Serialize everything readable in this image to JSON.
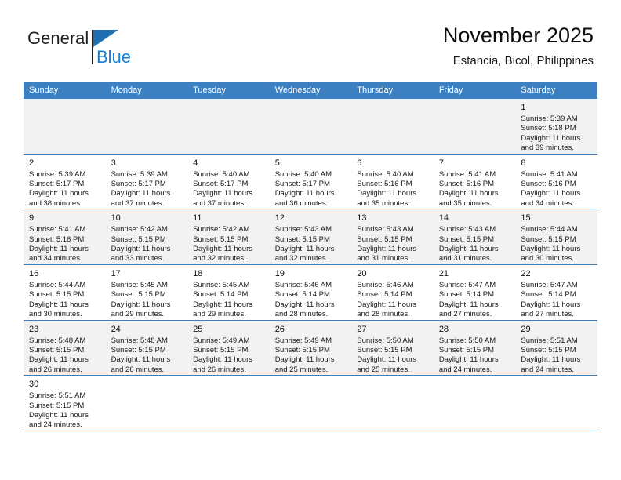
{
  "brand": {
    "name_part1": "General",
    "name_part2": "Blue"
  },
  "header": {
    "title": "November 2025",
    "subtitle": "Estancia, Bicol, Philippines"
  },
  "colors": {
    "header_blue": "#3d80c2",
    "logo_blue": "#1a7fd4",
    "shaded_row": "#f2f2f2"
  },
  "weekdays": [
    "Sunday",
    "Monday",
    "Tuesday",
    "Wednesday",
    "Thursday",
    "Friday",
    "Saturday"
  ],
  "weeks": [
    [
      {
        "day": "",
        "empty": true
      },
      {
        "day": "",
        "empty": true
      },
      {
        "day": "",
        "empty": true
      },
      {
        "day": "",
        "empty": true
      },
      {
        "day": "",
        "empty": true
      },
      {
        "day": "",
        "empty": true
      },
      {
        "day": "1",
        "sunrise": "Sunrise: 5:39 AM",
        "sunset": "Sunset: 5:18 PM",
        "daylight1": "Daylight: 11 hours",
        "daylight2": "and 39 minutes."
      }
    ],
    [
      {
        "day": "2",
        "sunrise": "Sunrise: 5:39 AM",
        "sunset": "Sunset: 5:17 PM",
        "daylight1": "Daylight: 11 hours",
        "daylight2": "and 38 minutes."
      },
      {
        "day": "3",
        "sunrise": "Sunrise: 5:39 AM",
        "sunset": "Sunset: 5:17 PM",
        "daylight1": "Daylight: 11 hours",
        "daylight2": "and 37 minutes."
      },
      {
        "day": "4",
        "sunrise": "Sunrise: 5:40 AM",
        "sunset": "Sunset: 5:17 PM",
        "daylight1": "Daylight: 11 hours",
        "daylight2": "and 37 minutes."
      },
      {
        "day": "5",
        "sunrise": "Sunrise: 5:40 AM",
        "sunset": "Sunset: 5:17 PM",
        "daylight1": "Daylight: 11 hours",
        "daylight2": "and 36 minutes."
      },
      {
        "day": "6",
        "sunrise": "Sunrise: 5:40 AM",
        "sunset": "Sunset: 5:16 PM",
        "daylight1": "Daylight: 11 hours",
        "daylight2": "and 35 minutes."
      },
      {
        "day": "7",
        "sunrise": "Sunrise: 5:41 AM",
        "sunset": "Sunset: 5:16 PM",
        "daylight1": "Daylight: 11 hours",
        "daylight2": "and 35 minutes."
      },
      {
        "day": "8",
        "sunrise": "Sunrise: 5:41 AM",
        "sunset": "Sunset: 5:16 PM",
        "daylight1": "Daylight: 11 hours",
        "daylight2": "and 34 minutes."
      }
    ],
    [
      {
        "day": "9",
        "sunrise": "Sunrise: 5:41 AM",
        "sunset": "Sunset: 5:16 PM",
        "daylight1": "Daylight: 11 hours",
        "daylight2": "and 34 minutes."
      },
      {
        "day": "10",
        "sunrise": "Sunrise: 5:42 AM",
        "sunset": "Sunset: 5:15 PM",
        "daylight1": "Daylight: 11 hours",
        "daylight2": "and 33 minutes."
      },
      {
        "day": "11",
        "sunrise": "Sunrise: 5:42 AM",
        "sunset": "Sunset: 5:15 PM",
        "daylight1": "Daylight: 11 hours",
        "daylight2": "and 32 minutes."
      },
      {
        "day": "12",
        "sunrise": "Sunrise: 5:43 AM",
        "sunset": "Sunset: 5:15 PM",
        "daylight1": "Daylight: 11 hours",
        "daylight2": "and 32 minutes."
      },
      {
        "day": "13",
        "sunrise": "Sunrise: 5:43 AM",
        "sunset": "Sunset: 5:15 PM",
        "daylight1": "Daylight: 11 hours",
        "daylight2": "and 31 minutes."
      },
      {
        "day": "14",
        "sunrise": "Sunrise: 5:43 AM",
        "sunset": "Sunset: 5:15 PM",
        "daylight1": "Daylight: 11 hours",
        "daylight2": "and 31 minutes."
      },
      {
        "day": "15",
        "sunrise": "Sunrise: 5:44 AM",
        "sunset": "Sunset: 5:15 PM",
        "daylight1": "Daylight: 11 hours",
        "daylight2": "and 30 minutes."
      }
    ],
    [
      {
        "day": "16",
        "sunrise": "Sunrise: 5:44 AM",
        "sunset": "Sunset: 5:15 PM",
        "daylight1": "Daylight: 11 hours",
        "daylight2": "and 30 minutes."
      },
      {
        "day": "17",
        "sunrise": "Sunrise: 5:45 AM",
        "sunset": "Sunset: 5:15 PM",
        "daylight1": "Daylight: 11 hours",
        "daylight2": "and 29 minutes."
      },
      {
        "day": "18",
        "sunrise": "Sunrise: 5:45 AM",
        "sunset": "Sunset: 5:14 PM",
        "daylight1": "Daylight: 11 hours",
        "daylight2": "and 29 minutes."
      },
      {
        "day": "19",
        "sunrise": "Sunrise: 5:46 AM",
        "sunset": "Sunset: 5:14 PM",
        "daylight1": "Daylight: 11 hours",
        "daylight2": "and 28 minutes."
      },
      {
        "day": "20",
        "sunrise": "Sunrise: 5:46 AM",
        "sunset": "Sunset: 5:14 PM",
        "daylight1": "Daylight: 11 hours",
        "daylight2": "and 28 minutes."
      },
      {
        "day": "21",
        "sunrise": "Sunrise: 5:47 AM",
        "sunset": "Sunset: 5:14 PM",
        "daylight1": "Daylight: 11 hours",
        "daylight2": "and 27 minutes."
      },
      {
        "day": "22",
        "sunrise": "Sunrise: 5:47 AM",
        "sunset": "Sunset: 5:14 PM",
        "daylight1": "Daylight: 11 hours",
        "daylight2": "and 27 minutes."
      }
    ],
    [
      {
        "day": "23",
        "sunrise": "Sunrise: 5:48 AM",
        "sunset": "Sunset: 5:15 PM",
        "daylight1": "Daylight: 11 hours",
        "daylight2": "and 26 minutes."
      },
      {
        "day": "24",
        "sunrise": "Sunrise: 5:48 AM",
        "sunset": "Sunset: 5:15 PM",
        "daylight1": "Daylight: 11 hours",
        "daylight2": "and 26 minutes."
      },
      {
        "day": "25",
        "sunrise": "Sunrise: 5:49 AM",
        "sunset": "Sunset: 5:15 PM",
        "daylight1": "Daylight: 11 hours",
        "daylight2": "and 26 minutes."
      },
      {
        "day": "26",
        "sunrise": "Sunrise: 5:49 AM",
        "sunset": "Sunset: 5:15 PM",
        "daylight1": "Daylight: 11 hours",
        "daylight2": "and 25 minutes."
      },
      {
        "day": "27",
        "sunrise": "Sunrise: 5:50 AM",
        "sunset": "Sunset: 5:15 PM",
        "daylight1": "Daylight: 11 hours",
        "daylight2": "and 25 minutes."
      },
      {
        "day": "28",
        "sunrise": "Sunrise: 5:50 AM",
        "sunset": "Sunset: 5:15 PM",
        "daylight1": "Daylight: 11 hours",
        "daylight2": "and 24 minutes."
      },
      {
        "day": "29",
        "sunrise": "Sunrise: 5:51 AM",
        "sunset": "Sunset: 5:15 PM",
        "daylight1": "Daylight: 11 hours",
        "daylight2": "and 24 minutes."
      }
    ],
    [
      {
        "day": "30",
        "sunrise": "Sunrise: 5:51 AM",
        "sunset": "Sunset: 5:15 PM",
        "daylight1": "Daylight: 11 hours",
        "daylight2": "and 24 minutes."
      },
      {
        "day": "",
        "empty": true
      },
      {
        "day": "",
        "empty": true
      },
      {
        "day": "",
        "empty": true
      },
      {
        "day": "",
        "empty": true
      },
      {
        "day": "",
        "empty": true
      },
      {
        "day": "",
        "empty": true
      }
    ]
  ]
}
